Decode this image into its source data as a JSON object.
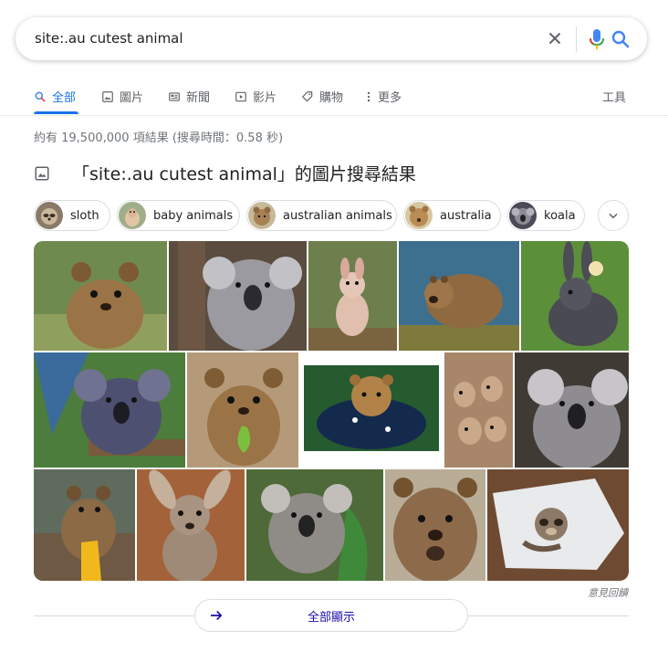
{
  "search": {
    "query": "site:.au cutest animal"
  },
  "tabs": [
    {
      "label": "全部",
      "icon": "search-icon"
    },
    {
      "label": "圖片",
      "icon": "image-icon"
    },
    {
      "label": "新聞",
      "icon": "news-icon"
    },
    {
      "label": "影片",
      "icon": "video-icon"
    },
    {
      "label": "購物",
      "icon": "tag-icon"
    },
    {
      "label": "更多",
      "icon": "more-vert-icon"
    }
  ],
  "tools_label": "工具",
  "result_stats": "約有 19,500,000 項結果 (搜尋時間：0.58 秒)",
  "images_heading": "「site:.au cutest animal」的圖片搜尋結果",
  "chips": [
    {
      "label": "sloth"
    },
    {
      "label": "baby animals"
    },
    {
      "label": "australian animals"
    },
    {
      "label": "australia"
    },
    {
      "label": "koala"
    }
  ],
  "images": [
    {
      "subject": "quokka"
    },
    {
      "subject": "koala"
    },
    {
      "subject": "baby kangaroo"
    },
    {
      "subject": "wombat"
    },
    {
      "subject": "rabbit with chick"
    },
    {
      "subject": "koala"
    },
    {
      "subject": "quokka"
    },
    {
      "subject": "quokka in sweater"
    },
    {
      "subject": "meerkats"
    },
    {
      "subject": "koala"
    },
    {
      "subject": "quokka"
    },
    {
      "subject": "kangaroo"
    },
    {
      "subject": "koala"
    },
    {
      "subject": "quokka"
    },
    {
      "subject": "sloth"
    }
  ],
  "feedback_label": "意見回饋",
  "show_all_label": "全部顯示",
  "colors": {
    "accent": "#1a73e8",
    "link": "#1a0dab",
    "muted": "#70757a"
  }
}
